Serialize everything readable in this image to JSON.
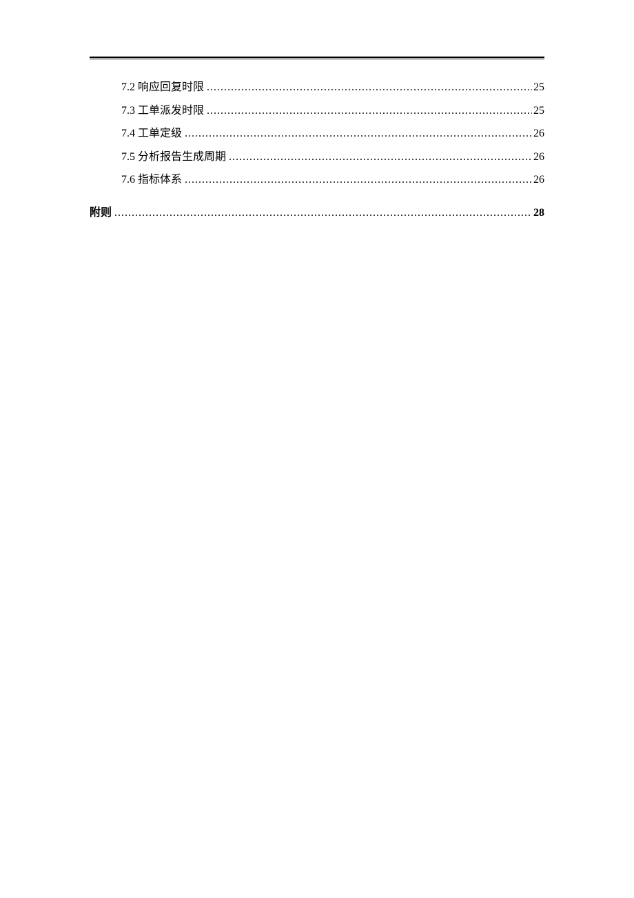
{
  "toc": {
    "sub_entries": [
      {
        "label": "7.2 响应回复时限",
        "page": "25"
      },
      {
        "label": "7.3 工单派发时限",
        "page": "25"
      },
      {
        "label": "7.4 工单定级",
        "page": "26"
      },
      {
        "label": "7.5 分析报告生成周期",
        "page": "26"
      },
      {
        "label": "7.6 指标体系",
        "page": "26"
      }
    ],
    "main_entry": {
      "label": "附则",
      "page": "28"
    }
  }
}
